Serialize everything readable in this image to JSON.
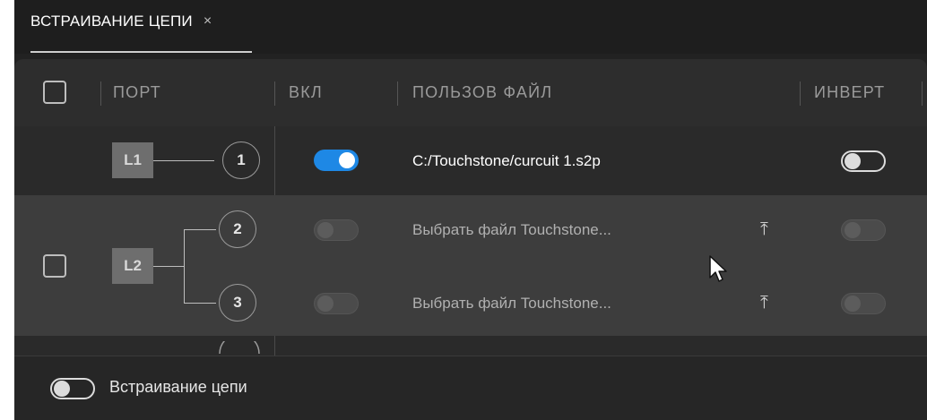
{
  "tab": {
    "label": "ВСТРАИВАНИЕ ЦЕПИ",
    "close_glyph": "×"
  },
  "table": {
    "headers": {
      "port": "ПОРТ",
      "enabled": "ВКЛ",
      "user_file": "ПОЛЬЗОВ ФАЙЛ",
      "invert": "ИНВЕРТ"
    },
    "rows": [
      {
        "block": "L1",
        "ports": [
          {
            "number": "1",
            "enabled": true,
            "file": "C:/Touchstone/curcuit 1.s2p",
            "invert": false
          }
        ]
      },
      {
        "block": "L2",
        "ports": [
          {
            "number": "2",
            "enabled": false,
            "file": "Выбрать файл Touchstone...",
            "invert": false,
            "upload_icon": "upload-icon"
          },
          {
            "number": "3",
            "enabled": false,
            "file": "Выбрать файл Touchstone...",
            "invert": false,
            "upload_icon": "upload-icon"
          }
        ]
      }
    ]
  },
  "footer": {
    "label": "Встраивание цепи",
    "enabled": false
  },
  "colors": {
    "accent": "#1e88e5",
    "background": "#222222",
    "selected_row": "#3d3d3d"
  }
}
